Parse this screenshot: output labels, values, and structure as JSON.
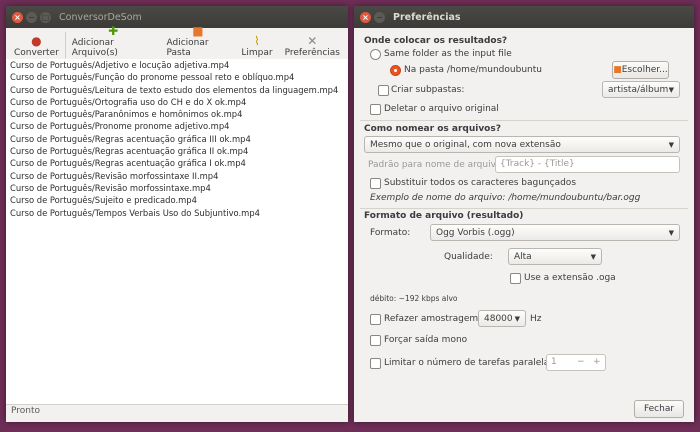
{
  "main": {
    "title": "ConversorDeSom",
    "toolbar": {
      "convert": "Converter",
      "add_files": "Adicionar Arquivo(s)",
      "add_folder": "Adicionar Pasta",
      "clear": "Limpar",
      "prefs": "Preferências"
    },
    "files": [
      "Curso de Português/Adjetivo e locução adjetiva.mp4",
      "Curso de Português/Função do pronome pessoal reto e oblíquo.mp4",
      "Curso de Português/Leitura de texto estudo dos elementos da linguagem.mp4",
      "Curso de Português/Ortografia uso do CH e do X ok.mp4",
      "Curso de Português/Paranônimos e homônimos ok.mp4",
      "Curso de Português/Pronome pronome adjetivo.mp4",
      "Curso de Português/Regras acentuação gráfica III ok.mp4",
      "Curso de Português/Regras acentuação gráfica II ok.mp4",
      "Curso de Português/Regras acentuação gráfica I ok.mp4",
      "Curso de Português/Revisão morfossintaxe II.mp4",
      "Curso de Português/Revisão morfossintaxe.mp4",
      "Curso de Português/Sujeito e predicado.mp4",
      "Curso de Português/Tempos Verbais Uso do Subjuntivo.mp4"
    ],
    "status": "Pronto"
  },
  "prefs": {
    "title": "Preferências",
    "where_header": "Onde colocar os resultados?",
    "same_folder": "Same folder as the input file",
    "in_folder": "Na pasta /home/mundoubuntu",
    "choose_btn": "Escolher...",
    "create_subfolders": "Criar subpastas:",
    "subfolder_combo": "artista/álbum",
    "delete_original": "Deletar o arquivo original",
    "naming_header": "Como nomear os arquivos?",
    "naming_combo": "Mesmo que o original, com nova extensão",
    "pattern_label": "Padrão para nome de arquivo:",
    "pattern_value": "{Track} - {Title}",
    "replace_messy": "Substituir todos os caracteres bagunçados",
    "example": "Exemplo de nome do arquivo: /home/mundoubuntu/bar.ogg",
    "format_header": "Formato de arquivo (resultado)",
    "format_label": "Formato:",
    "format_value": "Ogg Vorbis (.ogg)",
    "quality_label": "Qualidade:",
    "quality_value": "Alta",
    "oga_ext": "Use a extensão .oga",
    "bitrate": "débito: ~192 kbps alvo",
    "resample": "Refazer amostragem",
    "resample_value": "48000",
    "hz": "Hz",
    "force_mono": "Forçar saída mono",
    "limit_tasks": "Limitar o número de tarefas paralelas",
    "tasks_value": "1",
    "tasks_minus": "−",
    "tasks_plus": "+",
    "close_btn": "Fechar"
  },
  "colors": {
    "desktop": "#6e2e57",
    "accent": "#e95420",
    "titlebar": "#3c3b37"
  }
}
